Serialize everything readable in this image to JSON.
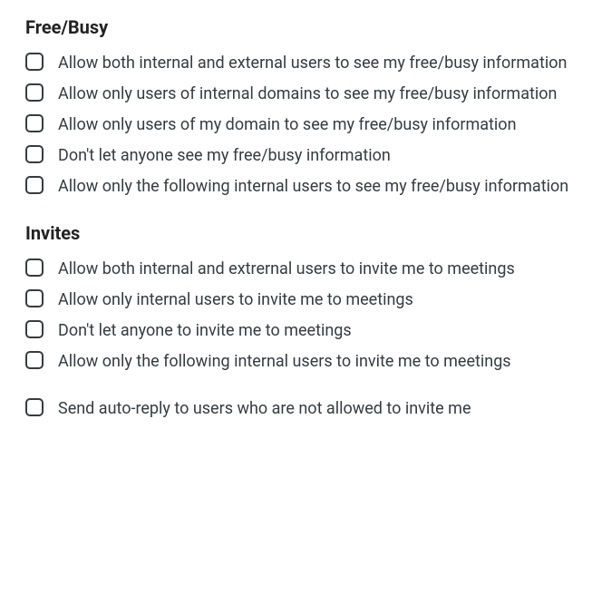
{
  "sections": {
    "freebusy": {
      "heading": "Free/Busy",
      "options": [
        "Allow both internal and external users to see my free/busy information",
        "Allow only users of internal domains to see my free/busy information",
        "Allow only users of my domain to see my free/busy information",
        "Don't let anyone see my free/busy information",
        "Allow only the following internal users to see my free/busy information"
      ]
    },
    "invites": {
      "heading": "Invites",
      "options": [
        "Allow both internal and extrernal users to invite me to meetings",
        "Allow only internal users to invite me to meetings",
        "Don't let anyone to invite me to meetings",
        "Allow only the following internal users to invite me to meetings"
      ],
      "extra": "Send auto-reply to users who are not allowed to invite me"
    }
  }
}
